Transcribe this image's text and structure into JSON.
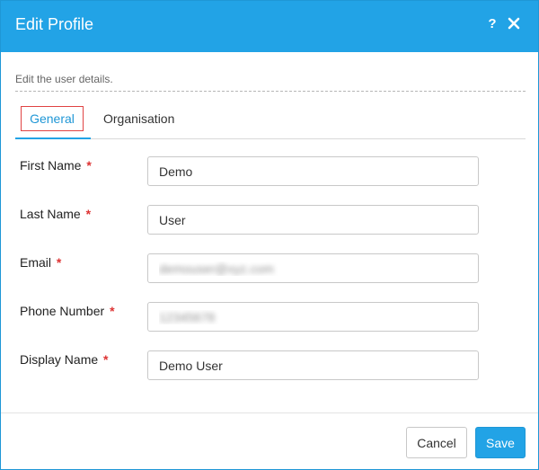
{
  "dialog": {
    "title": "Edit Profile",
    "help_icon": "help-icon",
    "close_icon": "close-icon",
    "subtitle": "Edit the user details."
  },
  "tabs": [
    {
      "label": "General",
      "active": true
    },
    {
      "label": "Organisation",
      "active": false
    }
  ],
  "fields": {
    "first_name": {
      "label": "First Name",
      "required_mark": "*",
      "value": "Demo"
    },
    "last_name": {
      "label": "Last Name",
      "required_mark": "*",
      "value": "User"
    },
    "email": {
      "label": "Email",
      "required_mark": "*",
      "value": "demouser@xyz.com"
    },
    "phone": {
      "label": "Phone Number",
      "required_mark": "*",
      "value": "12345678"
    },
    "display_name": {
      "label": "Display Name",
      "required_mark": "*",
      "value": "Demo User"
    }
  },
  "footer": {
    "cancel_label": "Cancel",
    "save_label": "Save"
  },
  "colors": {
    "accent": "#22a3e6",
    "required": "#d33333",
    "tab_highlight_border": "#e04343"
  }
}
